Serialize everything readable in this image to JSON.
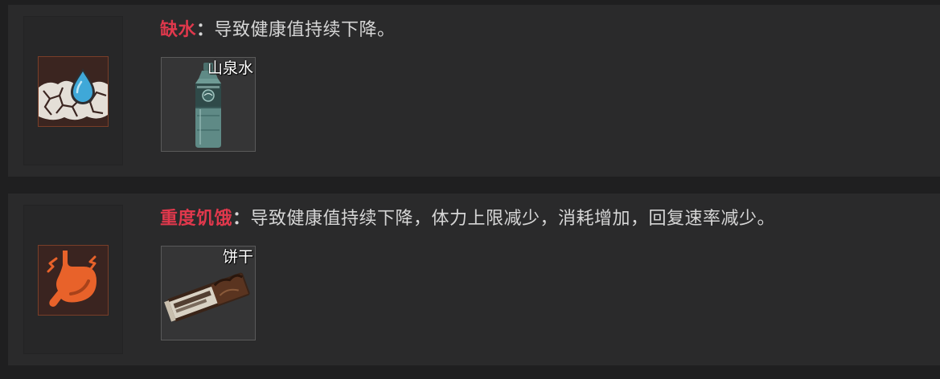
{
  "entries": [
    {
      "status": "缺水",
      "separator": "：",
      "description": "导致健康值持续下降。",
      "icon": "water-drop-cracked-ground-icon",
      "item": {
        "name": "山泉水",
        "icon": "water-bottle-icon"
      }
    },
    {
      "status": "重度饥饿",
      "separator": "：",
      "description": "导致健康值持续下降，体力上限减少，消耗增加，回复速率减少。",
      "icon": "stomach-icon",
      "item": {
        "name": "饼干",
        "icon": "biscuit-bar-icon"
      }
    }
  ],
  "colors": {
    "status_name": "#e0384c",
    "text": "#d6d6d6",
    "icon_accent": "#e8622a"
  }
}
